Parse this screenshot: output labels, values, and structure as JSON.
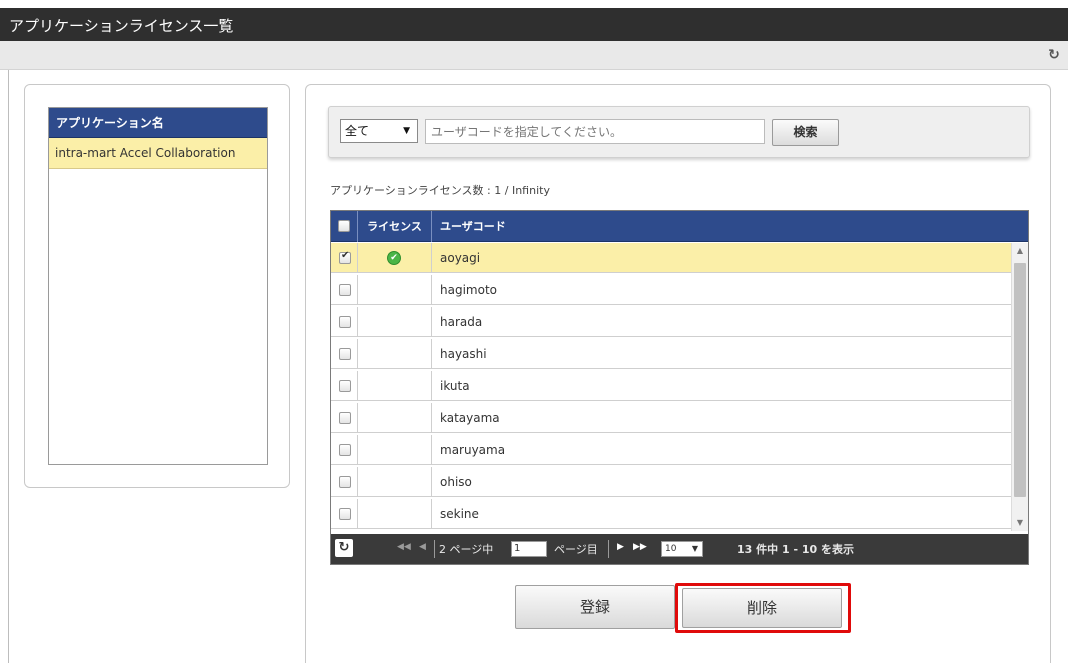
{
  "window": {
    "title": "アプリケーションライセンス一覧"
  },
  "toolbar": {
    "refresh_icon": "refresh-icon"
  },
  "app_list": {
    "header": "アプリケーション名",
    "items": [
      "intra-mart Accel Collaboration"
    ]
  },
  "search": {
    "filter_value": "全て",
    "placeholder": "ユーザコードを指定してください。",
    "button_label": "検索"
  },
  "license_count": "アプリケーションライセンス数 : 1 / Infinity",
  "grid": {
    "columns": [
      "",
      "ライセンス",
      "ユーザコード"
    ],
    "rows": [
      {
        "checked": true,
        "licensed": true,
        "user_code": "aoyagi",
        "selected": true
      },
      {
        "checked": false,
        "licensed": false,
        "user_code": "hagimoto",
        "selected": false
      },
      {
        "checked": false,
        "licensed": false,
        "user_code": "harada",
        "selected": false
      },
      {
        "checked": false,
        "licensed": false,
        "user_code": "hayashi",
        "selected": false
      },
      {
        "checked": false,
        "licensed": false,
        "user_code": "ikuta",
        "selected": false
      },
      {
        "checked": false,
        "licensed": false,
        "user_code": "katayama",
        "selected": false
      },
      {
        "checked": false,
        "licensed": false,
        "user_code": "maruyama",
        "selected": false
      },
      {
        "checked": false,
        "licensed": false,
        "user_code": "ohiso",
        "selected": false
      },
      {
        "checked": false,
        "licensed": false,
        "user_code": "sekine",
        "selected": false
      }
    ]
  },
  "pager": {
    "page_count_text": "2 ページ中",
    "page_value": "1",
    "page_suffix": "ページ目",
    "rows_per_page": "10",
    "summary": "13 件中 1 - 10 を表示"
  },
  "actions": {
    "register_label": "登録",
    "delete_label": "削除"
  },
  "colors": {
    "header_blue": "#2e4b8c",
    "selected_row": "#fbefa8",
    "highlight_red": "#e00a0a"
  }
}
